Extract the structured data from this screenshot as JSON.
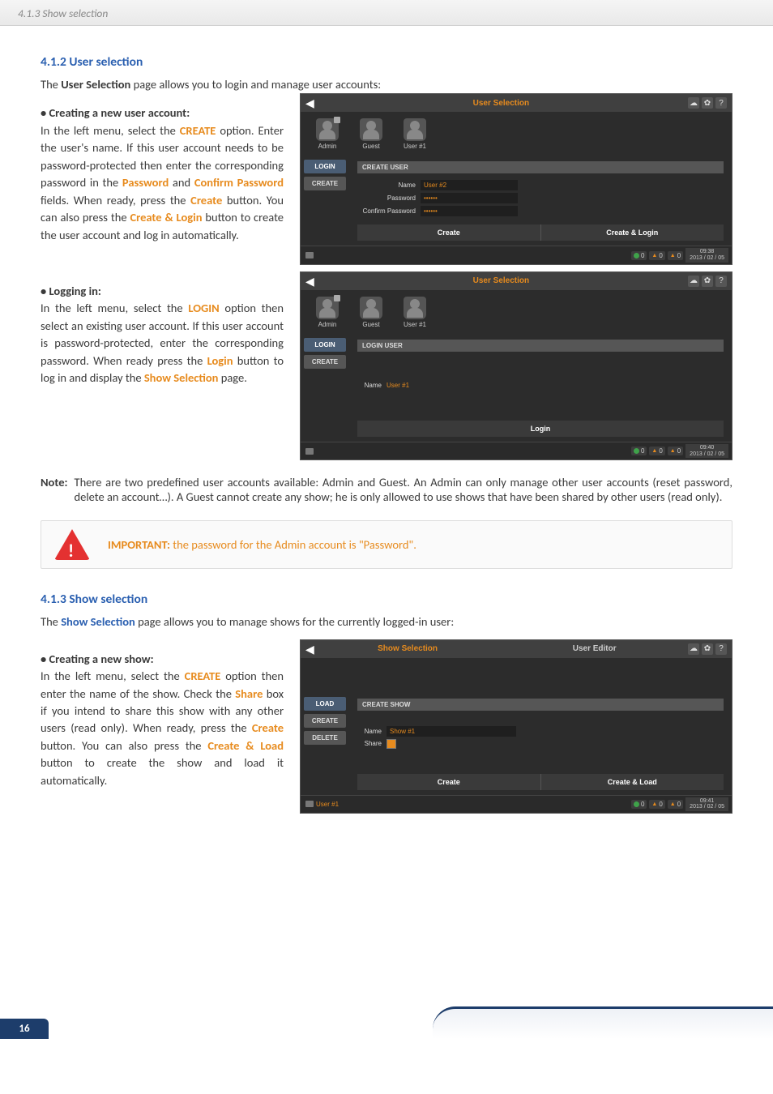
{
  "header_crumb": "4.1.3 Show selection",
  "section_412": {
    "heading": "4.1.2 User selection",
    "intro_pre": "The ",
    "intro_bold": "User Selection",
    "intro_post": " page allows you to login and manage user accounts:",
    "create": {
      "bullet": "• Creating a new user account:",
      "l1a": "In the left menu, select the ",
      "l1k1": "CREATE",
      "l1b": " option. Enter the user's name. If this user account needs to be password-protected then enter the corresponding password in the ",
      "l1k2": "Password",
      "l1c": " and ",
      "l1k3": "Confirm Password",
      "l1d": " fields. When ready, press the ",
      "l1k4": "Create",
      "l1e": " button. You can also press the ",
      "l1k5": "Create & Login",
      "l1f": " button to create the user account and log in automatically."
    },
    "login": {
      "bullet": "• Logging in:",
      "l1a": "In the left menu, select the ",
      "l1k1": "LOGIN",
      "l1b": " option then select an existing user account. If this user account is password-protected, enter the corresponding password. When ready press the ",
      "l1k2": "Login",
      "l1c": " button to log in and display the ",
      "l1k3": "Show Selection",
      "l1d": " page."
    },
    "note_lbl": "Note:",
    "note_body": "There are two predefined user accounts available: Admin and Guest. An Admin can only manage other user accounts (reset password, delete an account…). A Guest cannot create any show; he is only allowed to use shows that have been shared by other users (read only).",
    "important_lbl": "IMPORTANT:",
    "important_body": " the password for the Admin account is \"Password\"."
  },
  "section_413": {
    "heading": "4.1.3 Show selection",
    "intro_pre": "The ",
    "intro_bold": "Show Selection",
    "intro_post": " page allows you to manage shows for the currently logged-in user:",
    "create": {
      "bullet": "• Creating a new show:",
      "l1a": "In the left menu, select the ",
      "l1k1": "CREATE",
      "l1b": " option then enter the name of the show. Check the ",
      "l1k2": "Share",
      "l1c": " box if you intend to share this show with any other users (read only). When ready, press the ",
      "l1k3": "Create",
      "l1d": " button. You can also press the ",
      "l1k4": "Create & Load",
      "l1e": " button to create the show and load it automatically."
    }
  },
  "shots": {
    "s1": {
      "title": "User Selection",
      "users": [
        "Admin",
        "Guest",
        "User #1"
      ],
      "menu": [
        "LOGIN",
        "CREATE"
      ],
      "panel_head": "CREATE USER",
      "name_lbl": "Name",
      "name_val": "User #2",
      "pw_lbl": "Password",
      "pw_val": "••••••",
      "cpw_lbl": "Confirm Password",
      "cpw_val": "••••••",
      "btn1": "Create",
      "btn2": "Create & Login",
      "time": "09:38",
      "date": "2013 / 02 / 05"
    },
    "s2": {
      "title": "User Selection",
      "users": [
        "Admin",
        "Guest",
        "User #1"
      ],
      "menu": [
        "LOGIN",
        "CREATE"
      ],
      "panel_head": "LOGIN USER",
      "name_lbl": "Name",
      "name_val": "User #1",
      "btn1": "Login",
      "time": "09:40",
      "date": "2013 / 02 / 05"
    },
    "s3": {
      "tab1": "Show Selection",
      "tab2": "User Editor",
      "menu": [
        "LOAD",
        "CREATE",
        "DELETE"
      ],
      "panel_head": "CREATE SHOW",
      "name_lbl": "Name",
      "name_val": "Show #1",
      "share_lbl": "Share",
      "btn1": "Create",
      "btn2": "Create & Load",
      "sb_user": "User #1",
      "time": "09:41",
      "date": "2013 / 02 / 05"
    }
  },
  "page_number": "16"
}
